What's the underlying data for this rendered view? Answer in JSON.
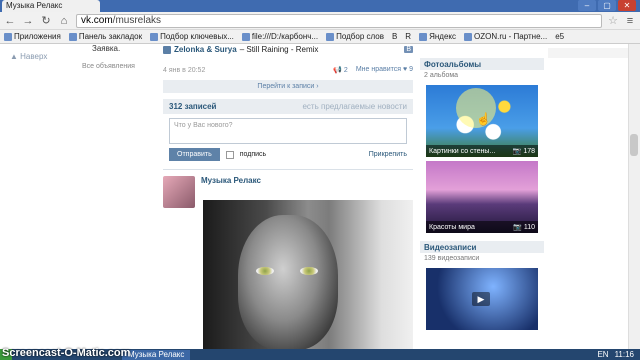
{
  "browser": {
    "tab_title": "Музыка Релакс",
    "url_host": "vk.com",
    "url_path": "/musrelaks",
    "controls": [
      "–",
      "▢",
      "✕"
    ]
  },
  "bookmarks": [
    "Приложения",
    "Панель закладок",
    "Подбор ключевых...",
    "file:///D:/карбонч...",
    "Подбор слов",
    "B",
    "R",
    "Яндекс",
    "OZON.ru - Партне...",
    "e5"
  ],
  "left": {
    "up_link": "Наверх",
    "app_text": "Заявка.",
    "all_ads": "Все объявления"
  },
  "wall": {
    "track_artist": "Zelonka & Surya",
    "track_title": "– Still Raining - Remix",
    "track_badge": "B",
    "post_date": "4 янв в 20:52",
    "reposts": "2",
    "likes_label": "Мне нравится",
    "likes_count": "9",
    "goto_link": "Перейти к записи ›",
    "records_count": "312 записей",
    "suggest_link": "есть предлагаемые новости",
    "compose_placeholder": "Что у Вас нового?",
    "send_button": "Отправить",
    "signature_label": "подпись",
    "attach_link": "Прикрепить",
    "post_author": "Музыка Релакс"
  },
  "right": {
    "albums_title": "Фотоальбомы",
    "albums_sub": "2 альбома",
    "albums": [
      {
        "name": "Картинки со стены...",
        "count": "178"
      },
      {
        "name": "Красоты мира",
        "count": "110"
      }
    ],
    "videos_title": "Видеозаписи",
    "videos_sub": "139 видеозаписи"
  },
  "taskbar": {
    "start_label": "Screencast-O-Matic.com",
    "active_window": "Музыка Релакс",
    "lang": "EN",
    "time": "11:16"
  }
}
